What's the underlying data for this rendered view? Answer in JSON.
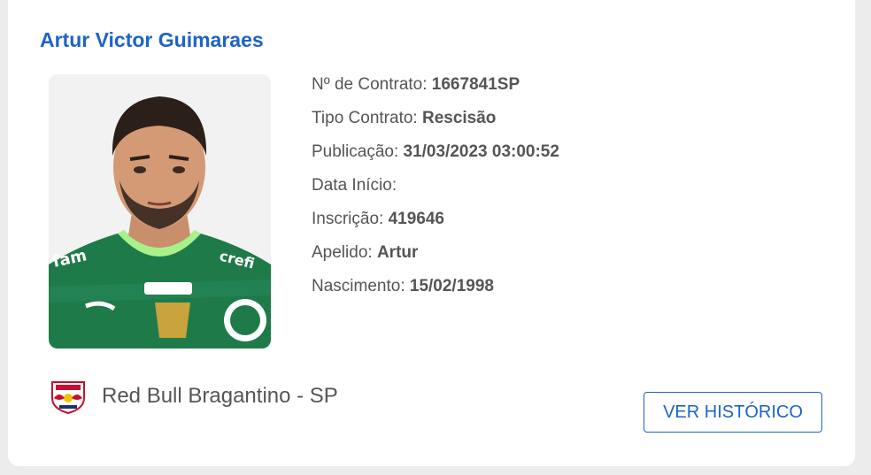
{
  "player": {
    "name": "Artur Victor Guimaraes",
    "photo_alt": "player-photo"
  },
  "details": [
    {
      "label": "Nº de Contrato:",
      "value": "1667841SP"
    },
    {
      "label": "Tipo Contrato:",
      "value": "Rescisão"
    },
    {
      "label": "Publicação:",
      "value": "31/03/2023 03:00:52"
    },
    {
      "label": "Data Início:",
      "value": ""
    },
    {
      "label": "Inscrição:",
      "value": "419646"
    },
    {
      "label": "Apelido:",
      "value": "Artur"
    },
    {
      "label": "Nascimento:",
      "value": "15/02/1998"
    }
  ],
  "club": {
    "name": "Red Bull Bragantino - SP",
    "logo_icon": "red-bull-bragantino-crest-icon"
  },
  "actions": {
    "history_label": "VER HISTÓRICO"
  },
  "colors": {
    "accent": "#1d63c8",
    "text": "#555555",
    "background": "#ececec",
    "card": "#ffffff",
    "jersey": "#1f7a4a"
  }
}
